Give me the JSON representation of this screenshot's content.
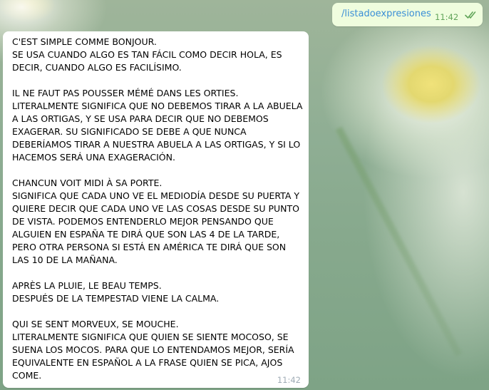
{
  "outgoing": {
    "text": "/listadoexpresiones",
    "time": "11:42",
    "status_icon": "double-check-icon"
  },
  "incoming": {
    "text": "C'EST SIMPLE COMME BONJOUR.\nSE USA CUANDO ALGO ES TAN FÁCIL COMO DECIR HOLA, ES DECIR, CUANDO ALGO ES FACILÍSIMO.\n\nIL NE FAUT PAS POUSSER MÉMÉ DANS LES ORTIES.\nLITERALMENTE SIGNIFICA QUE NO DEBEMOS TIRAR A LA ABUELA A LAS ORTIGAS, Y SE USA PARA DECIR QUE NO DEBEMOS EXAGERAR. SU SIGNIFICADO SE DEBE A QUE NUNCA DEBERÍAMOS TIRAR A NUESTRA ABUELA A LAS ORTIGAS, Y SI LO HACEMOS SERÁ UNA EXAGERACIÓN.\n\nCHANCUN VOIT MIDI À SA PORTE.\nSIGNIFICA QUE CADA UNO VE EL MEDIODÍA DESDE SU PUERTA Y QUIERE DECIR QUE CADA UNO VE LAS COSAS DESDE SU PUNTO DE VISTA. PODEMOS ENTENDERLO MEJOR PENSANDO QUE ALGUIEN EN ESPAÑA TE DIRÁ QUE SON LAS 4 DE LA TARDE, PERO OTRA PERSONA SI ESTÁ EN AMÉRICA TE DIRÁ QUE SON LAS 10 DE LA MAÑANA.\n\nAPRÈS LA PLUIE, LE BEAU TEMPS.\nDESPUÉS DE LA TEMPESTAD VIENE LA CALMA.\n\nQUI SE SENT MORVEUX, SE MOUCHE.\nLITERALMENTE SIGNIFICA QUE QUIEN SE SIENTE MOCOSO, SE SUENA LOS MOCOS. PARA QUE LO ENTENDAMOS MEJOR, SERÍA EQUIVALENTE EN ESPAÑOL A LA FRASE QUIEN SE PICA, AJOS COME.",
    "time": "11:42"
  },
  "colors": {
    "outgoing_bubble": "#effdde",
    "incoming_bubble": "#ffffff",
    "command_link": "#3a8ed6",
    "outgoing_time": "#62a55a",
    "incoming_time": "#a0acb6"
  }
}
